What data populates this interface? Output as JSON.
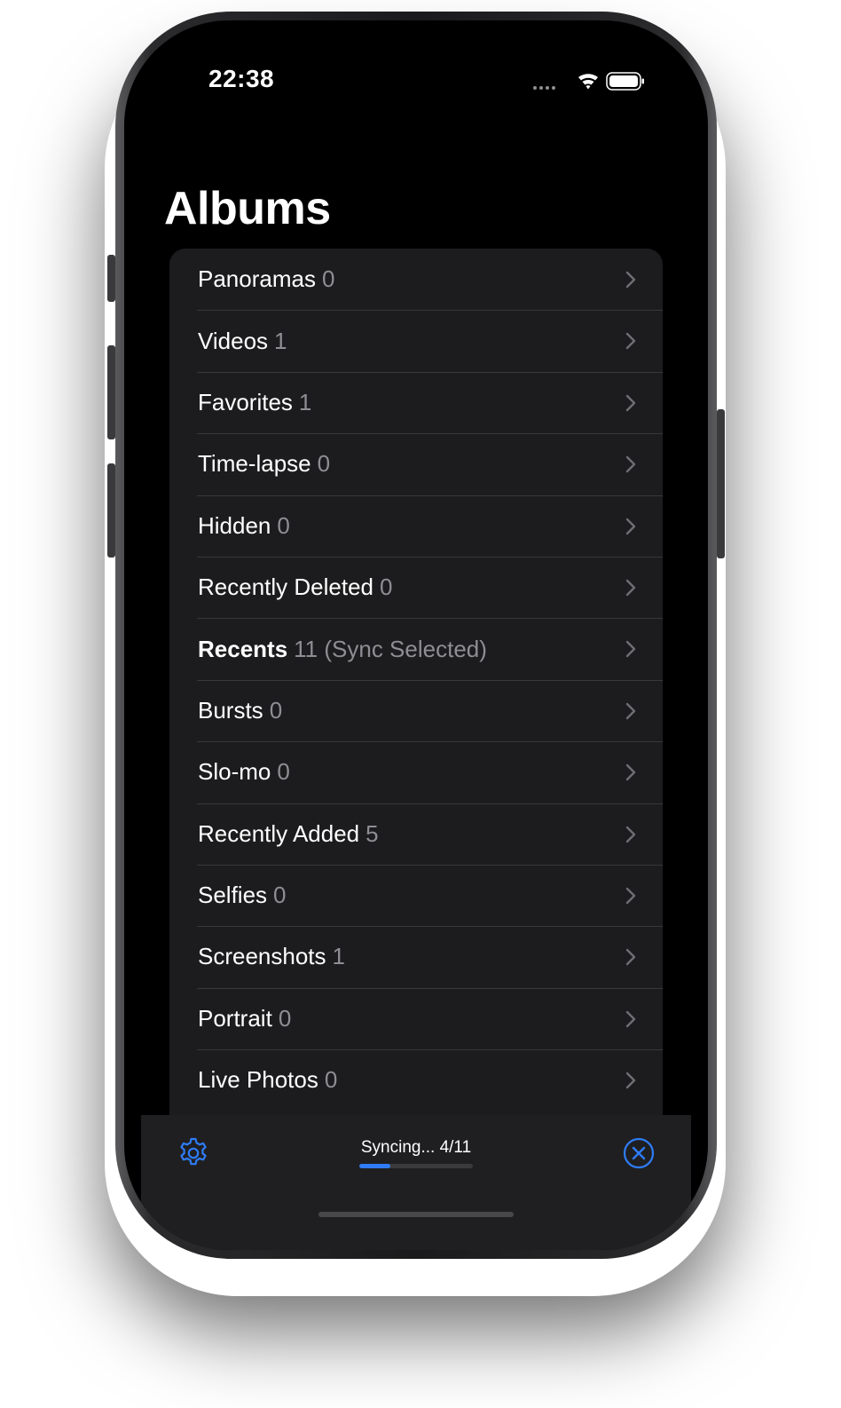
{
  "status_bar": {
    "time": "22:38"
  },
  "header": {
    "title": "Albums"
  },
  "albums": [
    {
      "name": "Panoramas",
      "count": "0",
      "bold": false
    },
    {
      "name": "Videos",
      "count": "1",
      "bold": false
    },
    {
      "name": "Favorites",
      "count": "1",
      "bold": false
    },
    {
      "name": "Time-lapse",
      "count": "0",
      "bold": false
    },
    {
      "name": "Hidden",
      "count": "0",
      "bold": false
    },
    {
      "name": "Recently Deleted",
      "count": "0",
      "bold": false
    },
    {
      "name": "Recents",
      "count": "11 (Sync Selected)",
      "bold": true
    },
    {
      "name": "Bursts",
      "count": "0",
      "bold": false
    },
    {
      "name": "Slo-mo",
      "count": "0",
      "bold": false
    },
    {
      "name": "Recently Added",
      "count": "5",
      "bold": false
    },
    {
      "name": "Selfies",
      "count": "0",
      "bold": false
    },
    {
      "name": "Screenshots",
      "count": "1",
      "bold": false
    },
    {
      "name": "Portrait",
      "count": "0",
      "bold": false
    },
    {
      "name": "Live Photos",
      "count": "0",
      "bold": false
    }
  ],
  "toolbar": {
    "sync_label": "Syncing... 4/11",
    "progress": 0.27,
    "settings_icon": "gear-icon",
    "cancel_icon": "close-circle-icon"
  },
  "colors": {
    "accent": "#2f7cf6",
    "background": "#000000",
    "row_bg": "#1c1c1e",
    "secondary_text": "#8e8e93"
  }
}
